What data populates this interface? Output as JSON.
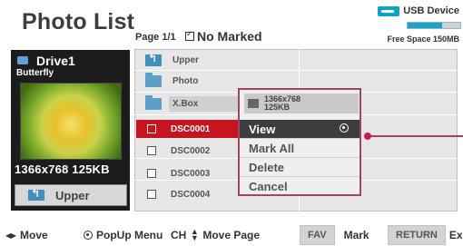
{
  "header": {
    "title": "Photo List",
    "page_info": "Page 1/1",
    "marked": "No Marked",
    "device": "USB Device",
    "free_space": "Free Space 150MB",
    "space_used_fraction": 0.65
  },
  "left_panel": {
    "drive_name": "Drive1",
    "file_name": "Butterfly",
    "resolution": "1366x768",
    "size": "125KB",
    "upper_button": "Upper"
  },
  "list": {
    "items": [
      {
        "type": "up",
        "label": "Upper"
      },
      {
        "type": "folder",
        "label": "Photo"
      },
      {
        "type": "folder",
        "label": "X.Box"
      },
      {
        "type": "file",
        "label": "DSC0001",
        "selected": true
      },
      {
        "type": "file",
        "label": "DSC0002"
      },
      {
        "type": "file",
        "label": "DSC0003"
      },
      {
        "type": "file",
        "label": "DSC0004"
      }
    ]
  },
  "popup": {
    "info_res": "1366x768",
    "info_size": "125KB",
    "menu": [
      "View",
      "Mark All",
      "Delete",
      "Cancel"
    ],
    "active_index": 0
  },
  "bottom": {
    "move": "Move",
    "popup_menu": "PopUp Menu",
    "ch": "CH",
    "move_page": "Move Page",
    "fav": "FAV",
    "mark": "Mark",
    "return": "RETURN",
    "exit": "Exit"
  },
  "colors": {
    "accent_red": "#c8141e",
    "popup_border": "#a3455e",
    "usb_blue": "#0aa4c9"
  }
}
